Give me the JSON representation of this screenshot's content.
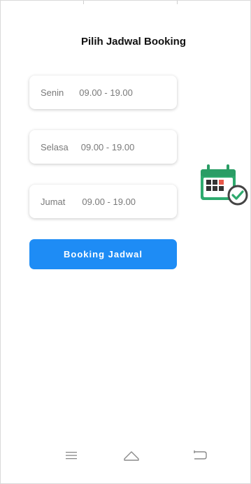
{
  "header": {
    "title": "Pilih Jadwal Booking"
  },
  "schedule": [
    {
      "day": "Senin",
      "time": "09.00 - 19.00"
    },
    {
      "day": "Selasa",
      "time": "09.00 - 19.00"
    },
    {
      "day": "Jumat",
      "time": "09.00 - 19.00"
    }
  ],
  "actions": {
    "booking_label": "Booking Jadwal"
  },
  "icons": {
    "illustration": "calendar-check-icon",
    "nav_menu": "menu-icon",
    "nav_home": "home-icon",
    "nav_back": "back-icon"
  },
  "colors": {
    "accent": "#1e8cf5",
    "calendar_green": "#2eaa6e",
    "calendar_red": "#e8584a",
    "text_muted": "#7a7a7a"
  }
}
